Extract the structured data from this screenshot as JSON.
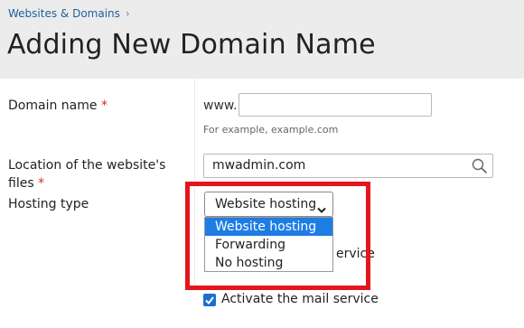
{
  "breadcrumb": {
    "item": "Websites & Domains",
    "separator": "›"
  },
  "page_title": "Adding New Domain Name",
  "domain_name": {
    "label": "Domain name",
    "required_mark": "*",
    "prefix": "www.",
    "value": "",
    "hint": "For example, example.com"
  },
  "location": {
    "label_line1": "Location of the website's",
    "label_line2": "files",
    "required_mark": "*",
    "value": "mwadmin.com"
  },
  "hosting_type": {
    "label": "Hosting type",
    "selected": "Website hosting",
    "options": [
      "Website hosting",
      "Forwarding",
      "No hosting"
    ]
  },
  "obscured_text": "ervice",
  "mail_service": {
    "label": "Activate the mail service",
    "checked": true
  },
  "colors": {
    "accent": "#1e7de4",
    "highlight": "#e5151d",
    "link": "#1f5e9e"
  }
}
